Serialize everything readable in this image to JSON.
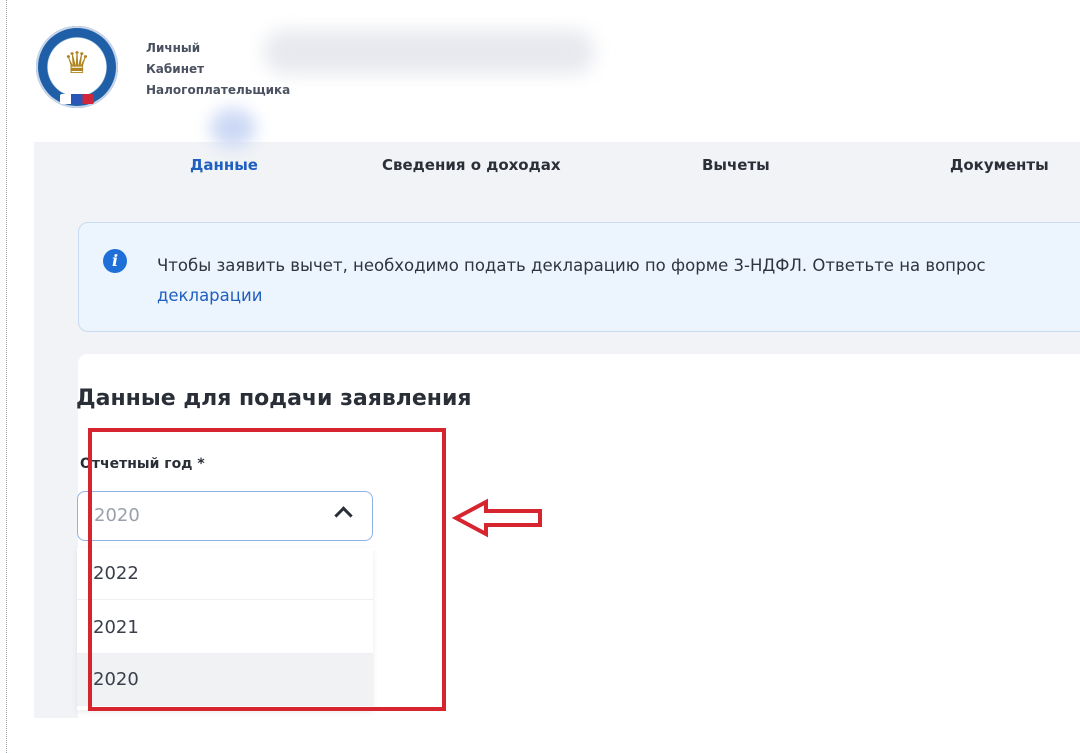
{
  "brand": {
    "line1": "Личный",
    "line2": "Кабинет",
    "line3": "Налогоплательщика"
  },
  "tabs": [
    {
      "label": "Данные",
      "active": true
    },
    {
      "label": "Сведения о доходах",
      "active": false
    },
    {
      "label": "Вычеты",
      "active": false
    },
    {
      "label": "Документы",
      "active": false
    }
  ],
  "info": {
    "text": "Чтобы заявить вычет, необходимо подать декларацию по форме 3-НДФЛ. Ответьте на вопрос",
    "link": "декларации"
  },
  "form": {
    "title": "Данные для подачи заявления",
    "year_label": "Отчетный год *",
    "selected_year": "2020",
    "options": [
      "2022",
      "2021",
      "2020"
    ]
  },
  "colors": {
    "accent": "#1f5fbf",
    "highlight": "#d6252f",
    "info_bg": "#ecf4fd"
  }
}
